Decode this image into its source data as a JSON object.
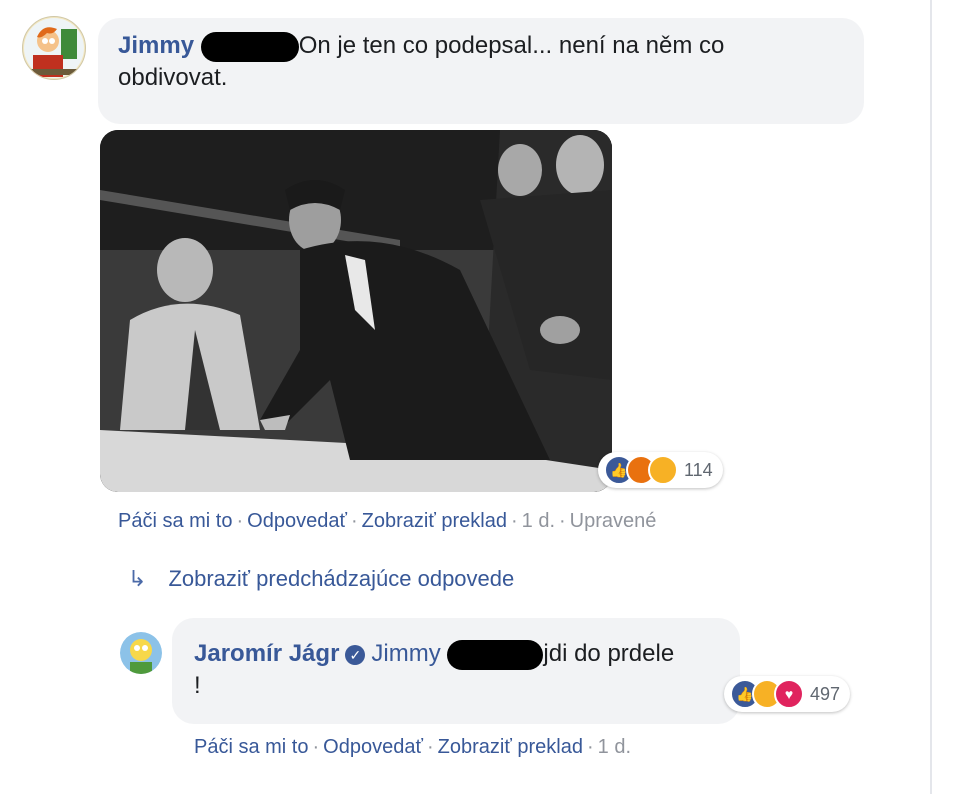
{
  "comment1": {
    "author": "Jimmy",
    "text_line1": "On je ten co podepsal... není na něm co",
    "text_line2": "obdivovat.",
    "reaction_count": "114",
    "actions": {
      "like": "Páči sa mi to",
      "reply": "Odpovedať",
      "translate": "Zobraziť preklad",
      "time": "1 d.",
      "edited": "Upravené"
    }
  },
  "view_previous": {
    "label": "Zobraziť predchádzajúce odpovede"
  },
  "comment2": {
    "author": "Jaromír Jágr",
    "mention": "Jimmy",
    "text_line1": "jdi do prdele",
    "text_line2": "!",
    "reaction_count": "497",
    "actions": {
      "like": "Páči sa mi to",
      "reply": "Odpovedať",
      "translate": "Zobraziť preklad",
      "time": "1 d."
    }
  },
  "colors": {
    "link": "#385898",
    "bubble": "#f2f3f5",
    "like_blue": "#3b5998",
    "angry": "#e9710f",
    "sad": "#f7b125",
    "love": "#e0245e",
    "haha": "#f7b125"
  },
  "icons": {
    "reply_arrow": "reply-arrow-icon",
    "verified": "verified-badge-icon",
    "like": "like-reaction-icon",
    "angry": "angry-reaction-icon",
    "sad": "sad-reaction-icon",
    "haha": "haha-reaction-icon",
    "love": "love-reaction-icon"
  }
}
